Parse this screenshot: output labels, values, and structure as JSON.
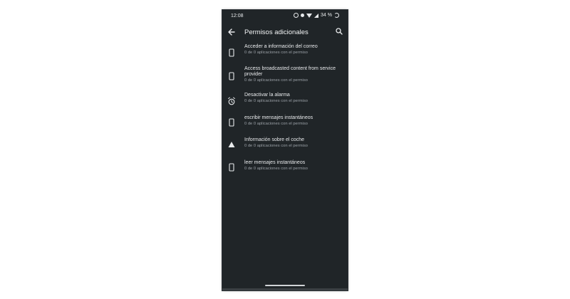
{
  "status_bar": {
    "time": "12:08",
    "battery": "34 %"
  },
  "toolbar": {
    "title": "Permisos adicionales"
  },
  "items": [
    {
      "title": "Acceder a información del correo",
      "subtitle": "0 de 0 aplicaciones con el permiso",
      "icon": "phone-icon"
    },
    {
      "title": "Access broadcasted content from service provider",
      "subtitle": "0 de 0 aplicaciones con el permiso",
      "icon": "phone-icon"
    },
    {
      "title": "Desactivar la alarma",
      "subtitle": "0 de 0 aplicaciones con el permiso",
      "icon": "alarm-icon"
    },
    {
      "title": "escribir mensajes instantáneos",
      "subtitle": "0 de 0 aplicaciones con el permiso",
      "icon": "phone-icon"
    },
    {
      "title": "Información sobre el coche",
      "subtitle": "0 de 0 aplicaciones con el permiso",
      "icon": "car-warning-icon"
    },
    {
      "title": "leer mensajes instantáneos",
      "subtitle": "0 de 0 aplicaciones con el permiso",
      "icon": "phone-icon"
    }
  ],
  "colors": {
    "background": "#202528",
    "text_primary": "#e8eaec",
    "text_secondary": "#9aa0a6"
  }
}
